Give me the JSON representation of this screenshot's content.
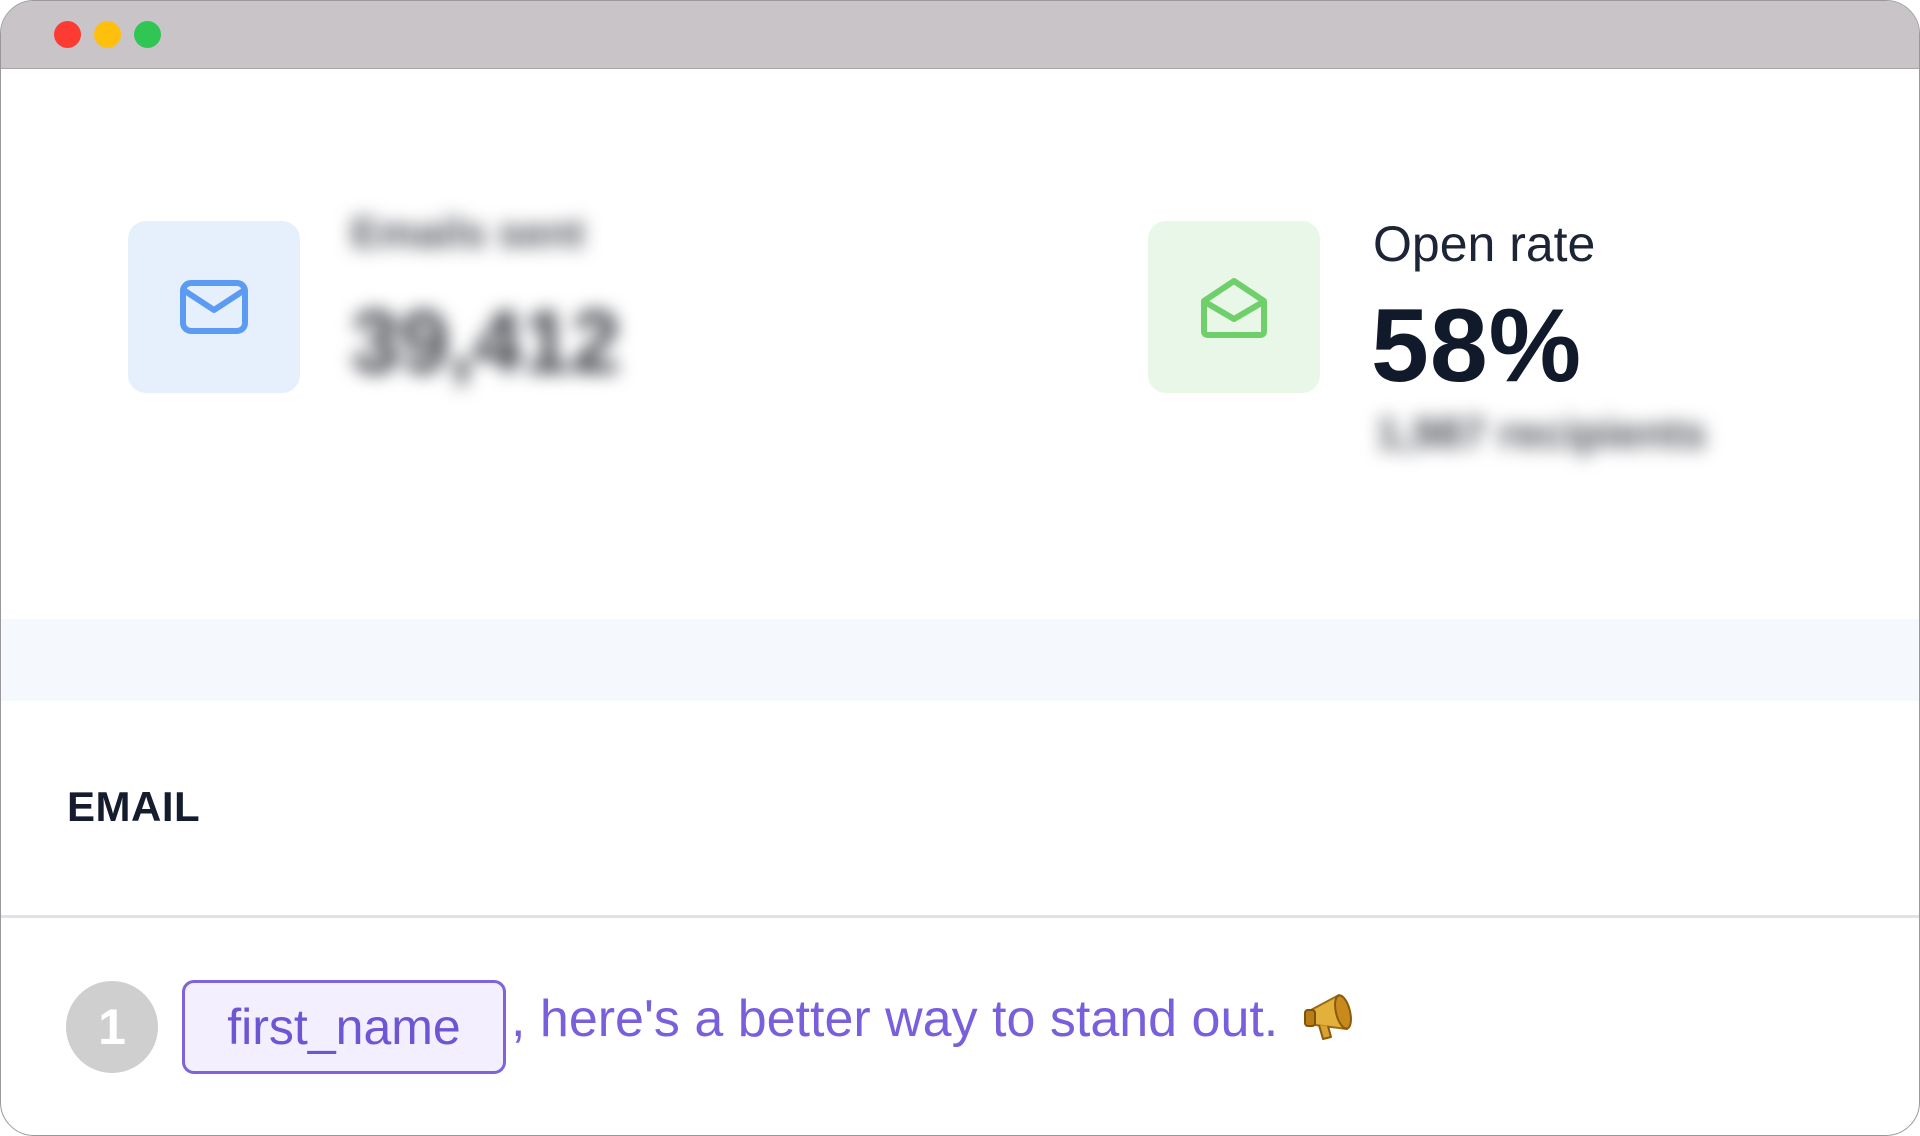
{
  "window": {
    "controls": [
      "close",
      "minimize",
      "maximize"
    ],
    "colors": {
      "close": "#fd3b32",
      "minimize": "#fec00d",
      "maximize": "#2fc653"
    }
  },
  "stats": {
    "sent": {
      "icon": "envelope-icon",
      "label": "Emails sent",
      "value": "39,412",
      "accent": "#5b9cf2"
    },
    "open": {
      "icon": "envelope-open-icon",
      "label": "Open rate",
      "value": "58%",
      "sub": "1,987 recipients",
      "accent": "#6fcf6a"
    }
  },
  "section": {
    "title": "EMAIL"
  },
  "step": {
    "number": "1",
    "token": "first_name",
    "text": ", here's a better way to stand out.",
    "emoji_icon": "megaphone-icon"
  }
}
